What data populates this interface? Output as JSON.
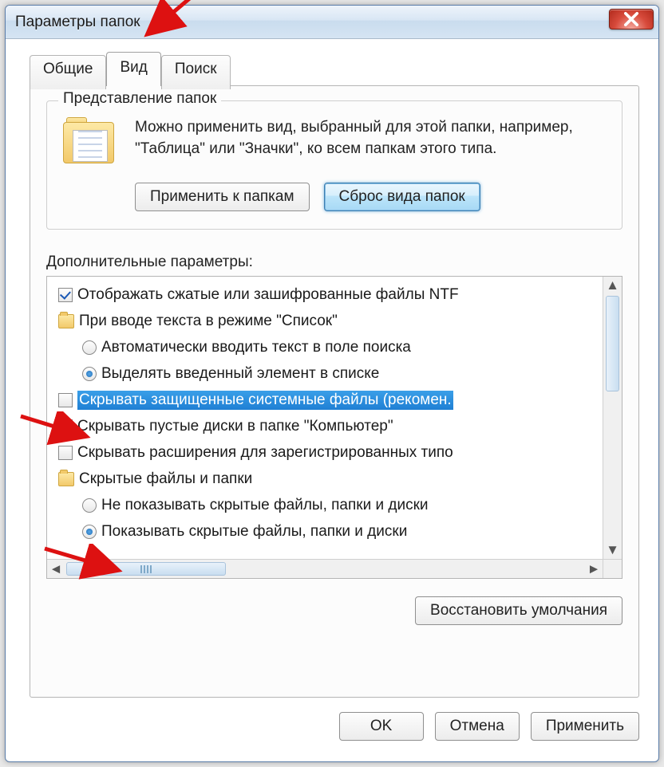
{
  "window": {
    "title": "Параметры папок"
  },
  "tabs": {
    "general": "Общие",
    "view": "Вид",
    "search": "Поиск"
  },
  "groupbox": {
    "title": "Представление папок",
    "description": "Можно применить вид, выбранный для этой папки, например, \"Таблица\" или \"Значки\", ко всем папкам этого типа.",
    "apply_to_folders": "Применить к папкам",
    "reset_folders": "Сброс вида папок"
  },
  "advanced": {
    "label": "Дополнительные параметры:"
  },
  "tree": {
    "items": [
      {
        "type": "checkbox",
        "checked": true,
        "label": "Отображать сжатые или зашифрованные файлы NTF"
      },
      {
        "type": "folder",
        "label": "При вводе текста в режиме \"Список\""
      },
      {
        "type": "radio",
        "checked": false,
        "indent": true,
        "label": "Автоматически вводить текст в поле поиска"
      },
      {
        "type": "radio",
        "checked": true,
        "indent": true,
        "label": "Выделять введенный элемент в списке"
      },
      {
        "type": "checkbox",
        "checked": false,
        "selected": true,
        "label": "Скрывать защищенные системные файлы (рекомен."
      },
      {
        "type": "checkbox",
        "checked": true,
        "label": "Скрывать пустые диски в папке \"Компьютер\""
      },
      {
        "type": "checkbox",
        "checked": false,
        "label": "Скрывать расширения для зарегистрированных типо"
      },
      {
        "type": "folder",
        "label": "Скрытые файлы и папки"
      },
      {
        "type": "radio",
        "checked": false,
        "indent": true,
        "label": "Не показывать скрытые файлы, папки и диски"
      },
      {
        "type": "radio",
        "checked": true,
        "indent": true,
        "label": "Показывать скрытые файлы, папки и диски"
      }
    ]
  },
  "buttons": {
    "restore_defaults": "Восстановить умолчания",
    "ok": "OK",
    "cancel": "Отмена",
    "apply": "Применить"
  }
}
